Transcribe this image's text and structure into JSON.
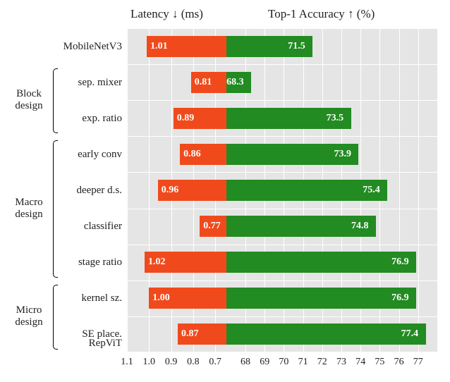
{
  "chart_data": {
    "type": "bar",
    "title_left": "Latency  ↓  (ms)",
    "title_right": "Top-1 Accuracy  ↑  (%)",
    "latency_axis": {
      "min": 0.65,
      "max": 1.1,
      "ticks": [
        1.1,
        1.0,
        0.9,
        0.8,
        0.7
      ]
    },
    "accuracy_axis": {
      "min": 67,
      "max": 78,
      "ticks": [
        68,
        69,
        70,
        71,
        72,
        73,
        74,
        75,
        76,
        77
      ]
    },
    "rows": [
      {
        "label": "MobileNetV3",
        "latency": 1.01,
        "accuracy": 71.5,
        "acc_label": "71.5"
      },
      {
        "label": "sep. mixer",
        "latency": 0.81,
        "accuracy": 68.3,
        "acc_label": "68.3"
      },
      {
        "label": "exp. ratio",
        "latency": 0.89,
        "accuracy": 73.5,
        "acc_label": "73.5"
      },
      {
        "label": "early conv",
        "latency": 0.86,
        "accuracy": 73.9,
        "acc_label": "73.9"
      },
      {
        "label": "deeper d.s.",
        "latency": 0.96,
        "accuracy": 75.4,
        "acc_label": "75.4"
      },
      {
        "label": "classifier",
        "latency": 0.77,
        "accuracy": 74.8,
        "acc_label": "74.8"
      },
      {
        "label": "stage ratio",
        "latency": 1.02,
        "accuracy": 76.9,
        "acc_label": "76.9"
      },
      {
        "label": "kernel sz.",
        "latency": 1.0,
        "accuracy": 76.9,
        "acc_label": "76.9"
      },
      {
        "label": "SE place.",
        "latency": 0.87,
        "accuracy": 77.4,
        "acc_label": "77.4"
      }
    ],
    "extra_last_label": "RepViT",
    "groups": [
      {
        "label_line1": "Block",
        "label_line2": "design",
        "from": 1,
        "to": 2
      },
      {
        "label_line1": "Macro",
        "label_line2": "design",
        "from": 3,
        "to": 6
      },
      {
        "label_line1": "Micro",
        "label_line2": "design",
        "from": 7,
        "to": 8
      }
    ]
  }
}
